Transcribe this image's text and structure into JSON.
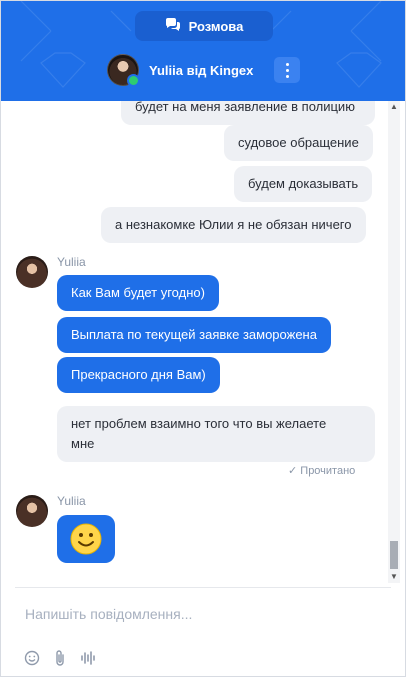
{
  "header": {
    "tab_label": "Розмова",
    "agent_name": "Yuliia від Kingex",
    "status": "online",
    "accent_color": "#1f6fe8"
  },
  "messages": [
    {
      "type": "incoming-partial",
      "text": "будет на меня заявление в полицию"
    },
    {
      "type": "user",
      "text": "судовое обращение"
    },
    {
      "type": "user",
      "text": "будем доказывать"
    },
    {
      "type": "user",
      "text": "а незнакомке Юлии я не обязан ничего"
    },
    {
      "sender": "Yuliia"
    },
    {
      "type": "agent",
      "text": "Как Вам будет угодно)"
    },
    {
      "type": "agent",
      "text": "Выплата по текущей заявке заморожена"
    },
    {
      "type": "agent",
      "text": "Прекрасного дня Вам)"
    },
    {
      "type": "user",
      "text": "нет проблем взаимно того что вы желаете мне",
      "line1": "нет проблем взаимно того что вы желаете",
      "line2": "мне"
    },
    {
      "read_status": "Прочитано"
    },
    {
      "sender": "Yuliia"
    },
    {
      "type": "agent-emoji",
      "text": "🙂"
    }
  ],
  "composer": {
    "placeholder": "Напишіть повідомлення..."
  },
  "icons": {
    "chat": "chat-bubbles-icon",
    "menu": "more-vertical-icon",
    "emoji": "emoji-icon",
    "attach": "paperclip-icon",
    "voice": "voice-wave-icon",
    "read": "check-icon"
  }
}
